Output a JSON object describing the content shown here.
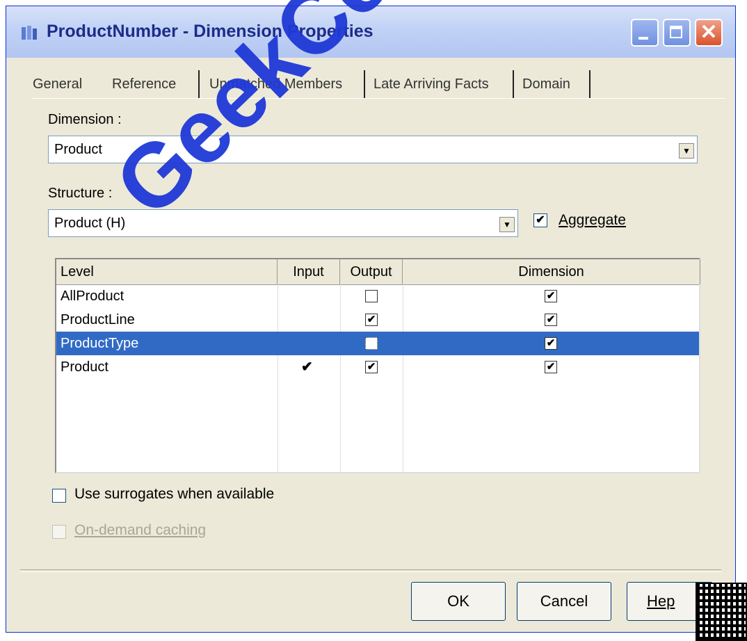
{
  "window": {
    "title": "ProductNumber - Dimension Properties",
    "accent_color": "#0a246a"
  },
  "tabs": [
    {
      "label": "General"
    },
    {
      "label": "Reference",
      "active": true
    },
    {
      "label": "Unmatched Members"
    },
    {
      "label": "Late Arriving Facts"
    },
    {
      "label": "Domain"
    }
  ],
  "dimension": {
    "label": "Dimension :",
    "value": "Product"
  },
  "structure": {
    "label": "Structure :",
    "value": "Product (H)"
  },
  "aggregate": {
    "label": "Aggregate",
    "checked": true
  },
  "grid": {
    "columns": [
      "Level",
      "Input",
      "Output",
      "Dimension"
    ],
    "rows": [
      {
        "level": "AllProduct",
        "input": false,
        "output": false,
        "dimension": true
      },
      {
        "level": "ProductLine",
        "input": false,
        "output": true,
        "dimension": true
      },
      {
        "level": "ProductType",
        "input": false,
        "output": false,
        "dimension": true,
        "selected": true
      },
      {
        "level": "Product",
        "input": true,
        "output": true,
        "dimension": true
      }
    ]
  },
  "options": {
    "surrogates": {
      "label": "Use surrogates when available",
      "checked": false
    },
    "caching": {
      "label": "On-demand caching",
      "checked": false,
      "disabled": true
    }
  },
  "buttons": {
    "ok": "OK",
    "cancel": "Cancel",
    "help": "Hep"
  },
  "watermark": "GeekCert.com",
  "icons": {
    "glyph_check": "✔",
    "glyph_tick": "✓"
  }
}
